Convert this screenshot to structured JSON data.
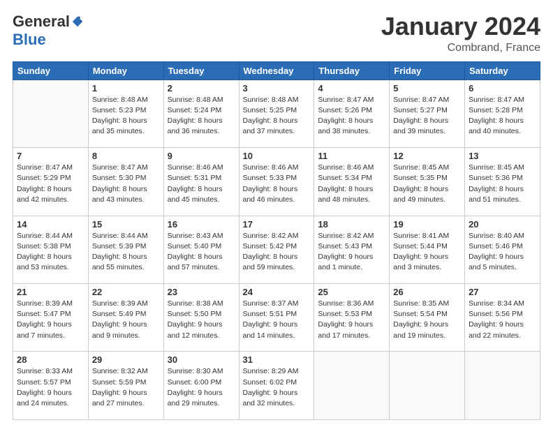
{
  "logo": {
    "general": "General",
    "blue": "Blue"
  },
  "title": "January 2024",
  "subtitle": "Combrand, France",
  "headers": [
    "Sunday",
    "Monday",
    "Tuesday",
    "Wednesday",
    "Thursday",
    "Friday",
    "Saturday"
  ],
  "weeks": [
    [
      {
        "day": "",
        "info": ""
      },
      {
        "day": "1",
        "info": "Sunrise: 8:48 AM\nSunset: 5:23 PM\nDaylight: 8 hours\nand 35 minutes."
      },
      {
        "day": "2",
        "info": "Sunrise: 8:48 AM\nSunset: 5:24 PM\nDaylight: 8 hours\nand 36 minutes."
      },
      {
        "day": "3",
        "info": "Sunrise: 8:48 AM\nSunset: 5:25 PM\nDaylight: 8 hours\nand 37 minutes."
      },
      {
        "day": "4",
        "info": "Sunrise: 8:47 AM\nSunset: 5:26 PM\nDaylight: 8 hours\nand 38 minutes."
      },
      {
        "day": "5",
        "info": "Sunrise: 8:47 AM\nSunset: 5:27 PM\nDaylight: 8 hours\nand 39 minutes."
      },
      {
        "day": "6",
        "info": "Sunrise: 8:47 AM\nSunset: 5:28 PM\nDaylight: 8 hours\nand 40 minutes."
      }
    ],
    [
      {
        "day": "7",
        "info": "Sunrise: 8:47 AM\nSunset: 5:29 PM\nDaylight: 8 hours\nand 42 minutes."
      },
      {
        "day": "8",
        "info": "Sunrise: 8:47 AM\nSunset: 5:30 PM\nDaylight: 8 hours\nand 43 minutes."
      },
      {
        "day": "9",
        "info": "Sunrise: 8:46 AM\nSunset: 5:31 PM\nDaylight: 8 hours\nand 45 minutes."
      },
      {
        "day": "10",
        "info": "Sunrise: 8:46 AM\nSunset: 5:33 PM\nDaylight: 8 hours\nand 46 minutes."
      },
      {
        "day": "11",
        "info": "Sunrise: 8:46 AM\nSunset: 5:34 PM\nDaylight: 8 hours\nand 48 minutes."
      },
      {
        "day": "12",
        "info": "Sunrise: 8:45 AM\nSunset: 5:35 PM\nDaylight: 8 hours\nand 49 minutes."
      },
      {
        "day": "13",
        "info": "Sunrise: 8:45 AM\nSunset: 5:36 PM\nDaylight: 8 hours\nand 51 minutes."
      }
    ],
    [
      {
        "day": "14",
        "info": "Sunrise: 8:44 AM\nSunset: 5:38 PM\nDaylight: 8 hours\nand 53 minutes."
      },
      {
        "day": "15",
        "info": "Sunrise: 8:44 AM\nSunset: 5:39 PM\nDaylight: 8 hours\nand 55 minutes."
      },
      {
        "day": "16",
        "info": "Sunrise: 8:43 AM\nSunset: 5:40 PM\nDaylight: 8 hours\nand 57 minutes."
      },
      {
        "day": "17",
        "info": "Sunrise: 8:42 AM\nSunset: 5:42 PM\nDaylight: 8 hours\nand 59 minutes."
      },
      {
        "day": "18",
        "info": "Sunrise: 8:42 AM\nSunset: 5:43 PM\nDaylight: 9 hours\nand 1 minute."
      },
      {
        "day": "19",
        "info": "Sunrise: 8:41 AM\nSunset: 5:44 PM\nDaylight: 9 hours\nand 3 minutes."
      },
      {
        "day": "20",
        "info": "Sunrise: 8:40 AM\nSunset: 5:46 PM\nDaylight: 9 hours\nand 5 minutes."
      }
    ],
    [
      {
        "day": "21",
        "info": "Sunrise: 8:39 AM\nSunset: 5:47 PM\nDaylight: 9 hours\nand 7 minutes."
      },
      {
        "day": "22",
        "info": "Sunrise: 8:39 AM\nSunset: 5:49 PM\nDaylight: 9 hours\nand 9 minutes."
      },
      {
        "day": "23",
        "info": "Sunrise: 8:38 AM\nSunset: 5:50 PM\nDaylight: 9 hours\nand 12 minutes."
      },
      {
        "day": "24",
        "info": "Sunrise: 8:37 AM\nSunset: 5:51 PM\nDaylight: 9 hours\nand 14 minutes."
      },
      {
        "day": "25",
        "info": "Sunrise: 8:36 AM\nSunset: 5:53 PM\nDaylight: 9 hours\nand 17 minutes."
      },
      {
        "day": "26",
        "info": "Sunrise: 8:35 AM\nSunset: 5:54 PM\nDaylight: 9 hours\nand 19 minutes."
      },
      {
        "day": "27",
        "info": "Sunrise: 8:34 AM\nSunset: 5:56 PM\nDaylight: 9 hours\nand 22 minutes."
      }
    ],
    [
      {
        "day": "28",
        "info": "Sunrise: 8:33 AM\nSunset: 5:57 PM\nDaylight: 9 hours\nand 24 minutes."
      },
      {
        "day": "29",
        "info": "Sunrise: 8:32 AM\nSunset: 5:59 PM\nDaylight: 9 hours\nand 27 minutes."
      },
      {
        "day": "30",
        "info": "Sunrise: 8:30 AM\nSunset: 6:00 PM\nDaylight: 9 hours\nand 29 minutes."
      },
      {
        "day": "31",
        "info": "Sunrise: 8:29 AM\nSunset: 6:02 PM\nDaylight: 9 hours\nand 32 minutes."
      },
      {
        "day": "",
        "info": ""
      },
      {
        "day": "",
        "info": ""
      },
      {
        "day": "",
        "info": ""
      }
    ]
  ]
}
